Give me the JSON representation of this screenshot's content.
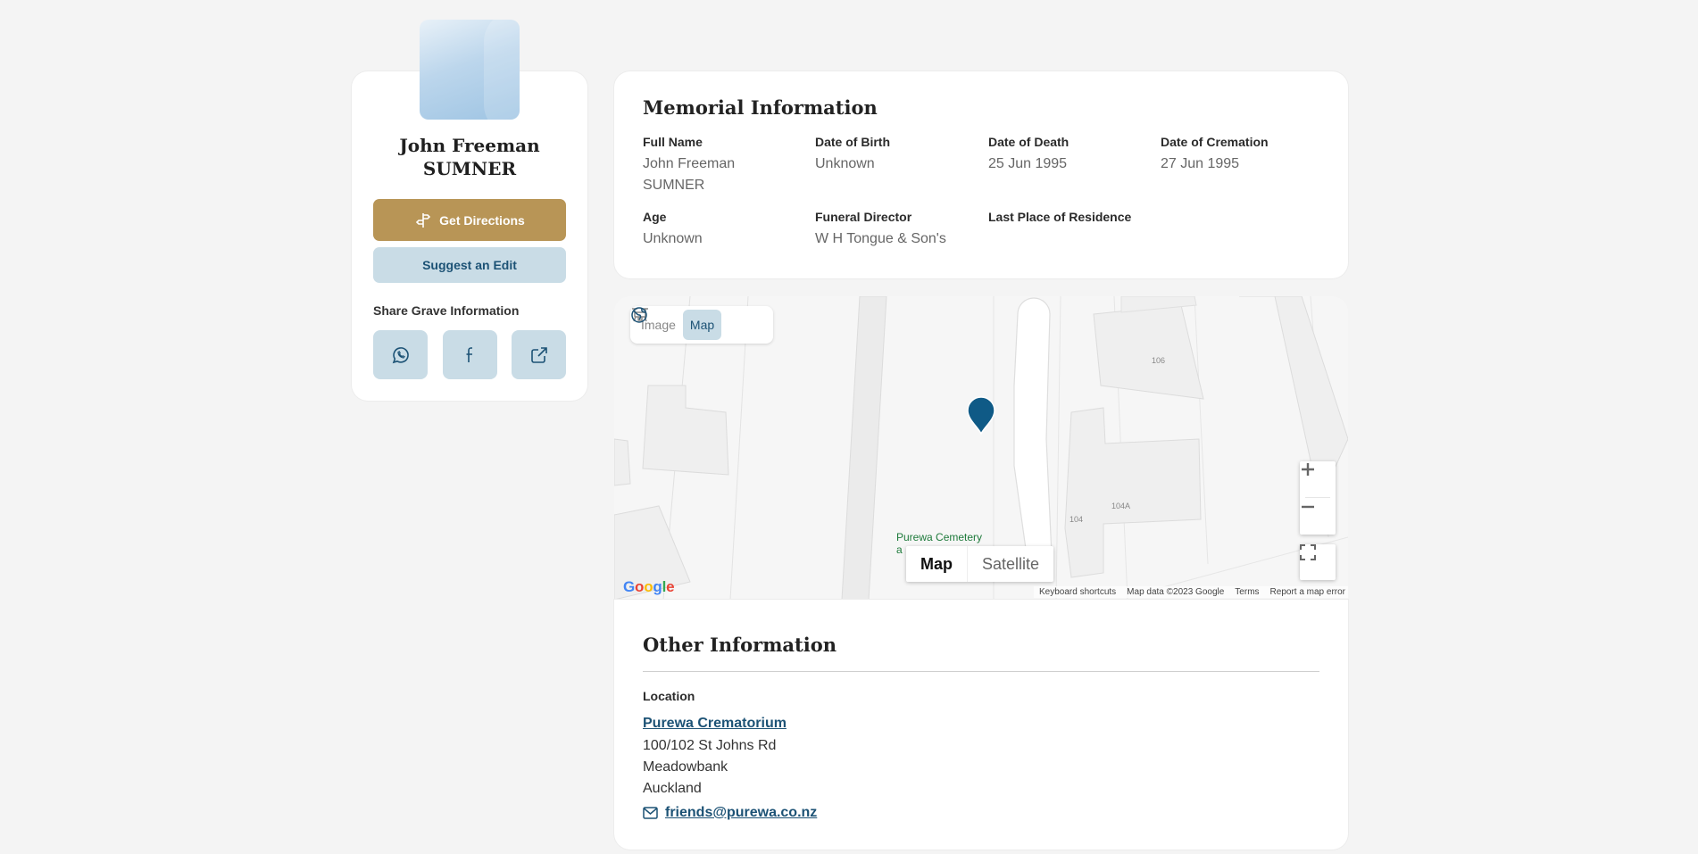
{
  "profile": {
    "name_line1": "John Freeman",
    "name_line2": "SUMNER",
    "directions_label": "Get Directions",
    "suggest_label": "Suggest an Edit",
    "share_label": "Share Grave Information",
    "share_icons": [
      "whatsapp-icon",
      "facebook-icon",
      "share-link-icon"
    ]
  },
  "memorial": {
    "title": "Memorial Information",
    "fields": [
      {
        "label": "Full Name",
        "value": "John Freeman SUMNER"
      },
      {
        "label": "Date of Birth",
        "value": "Unknown"
      },
      {
        "label": "Date of Death",
        "value": "25 Jun 1995"
      },
      {
        "label": "Date of Cremation",
        "value": "27 Jun 1995"
      },
      {
        "label": "Age",
        "value": "Unknown"
      },
      {
        "label": "Funeral Director",
        "value": "W H Tongue & Son's"
      },
      {
        "label": "Last Place of Residence",
        "value": ""
      }
    ]
  },
  "map": {
    "toggle_image": "Image",
    "toggle_map": "Map",
    "maptype_map": "Map",
    "maptype_satellite": "Satellite",
    "zoom_in": "+",
    "zoom_out": "−",
    "cemetery_label_1": "Purewa Cemetery",
    "cemetery_label_2": "a",
    "house_numbers": [
      "106",
      "104",
      "104A"
    ],
    "footer": [
      "Keyboard shortcuts",
      "Map data ©2023 Google",
      "Terms",
      "Report a map error"
    ],
    "google": "Google",
    "marker_color": "#0f5a86"
  },
  "other": {
    "title": "Other Information",
    "location_label": "Location",
    "location_name": "Purewa Crematorium",
    "address": [
      "100/102 St Johns Rd",
      "Meadowbank",
      "Auckland"
    ],
    "email": "friends@purewa.co.nz"
  },
  "colors": {
    "accent_gold": "#b89556",
    "accent_light_blue": "#c9dce6",
    "link_blue": "#1c5275"
  }
}
